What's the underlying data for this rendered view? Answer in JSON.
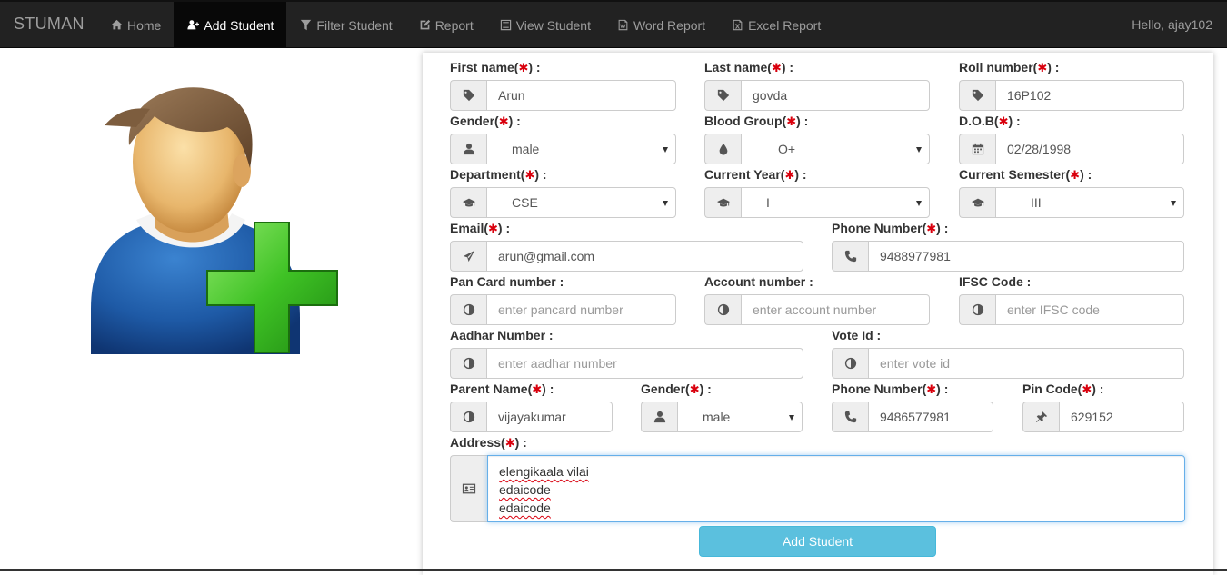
{
  "nav": {
    "brand": "STUMAN",
    "items": [
      {
        "label": "Home",
        "icon": "home-icon"
      },
      {
        "label": "Add Student",
        "icon": "add-user-icon",
        "active": true
      },
      {
        "label": "Filter Student",
        "icon": "filter-icon"
      },
      {
        "label": "Report",
        "icon": "edit-icon"
      },
      {
        "label": "View Student",
        "icon": "list-icon"
      },
      {
        "label": "Word Report",
        "icon": "word-file-icon"
      },
      {
        "label": "Excel Report",
        "icon": "excel-file-icon"
      }
    ],
    "greeting": "Hello, ajay102"
  },
  "form": {
    "required_mark": "✱",
    "first_name": {
      "label": "First name(",
      "suffix": ") :",
      "value": "Arun"
    },
    "last_name": {
      "label": "Last name(",
      "suffix": ") :",
      "value": "govda"
    },
    "roll_number": {
      "label": "Roll number(",
      "suffix": ") :",
      "value": "16P102"
    },
    "gender": {
      "label": "Gender(",
      "suffix": ") :",
      "value": "male"
    },
    "blood_group": {
      "label": "Blood Group(",
      "suffix": ") :",
      "value": "O+"
    },
    "dob": {
      "label": "D.O.B(",
      "suffix": ") :",
      "value": "02/28/1998"
    },
    "department": {
      "label": "Department(",
      "suffix": ") :",
      "value": "CSE"
    },
    "current_year": {
      "label": "Current Year(",
      "suffix": ") :",
      "value": "I"
    },
    "current_semester": {
      "label": "Current Semester(",
      "suffix": ") :",
      "value": "III"
    },
    "email": {
      "label": "Email(",
      "suffix": ") :",
      "value": "arun@gmail.com"
    },
    "phone": {
      "label": "Phone Number(",
      "suffix": ") :",
      "value": "9488977981"
    },
    "pan": {
      "label": "Pan Card number :",
      "placeholder": "enter pancard number"
    },
    "account": {
      "label": "Account number :",
      "placeholder": "enter account number"
    },
    "ifsc": {
      "label": "IFSC Code :",
      "placeholder": "enter IFSC code"
    },
    "aadhar": {
      "label": "Aadhar Number :",
      "placeholder": "enter aadhar number"
    },
    "vote": {
      "label": "Vote Id :",
      "placeholder": "enter vote id"
    },
    "parent_name": {
      "label": "Parent Name(",
      "suffix": ") :",
      "value": "vijayakumar"
    },
    "parent_gender": {
      "label": "Gender(",
      "suffix": ") :",
      "value": "male"
    },
    "parent_phone": {
      "label": "Phone Number(",
      "suffix": ") :",
      "value": "9486577981"
    },
    "pin_code": {
      "label": "Pin Code(",
      "suffix": ") :",
      "value": "629152"
    },
    "address": {
      "label": "Address(",
      "suffix": ") :",
      "lines": [
        "elengikaala vilai",
        "edaicode",
        "edaicode"
      ]
    },
    "submit_label": "Add Student"
  }
}
